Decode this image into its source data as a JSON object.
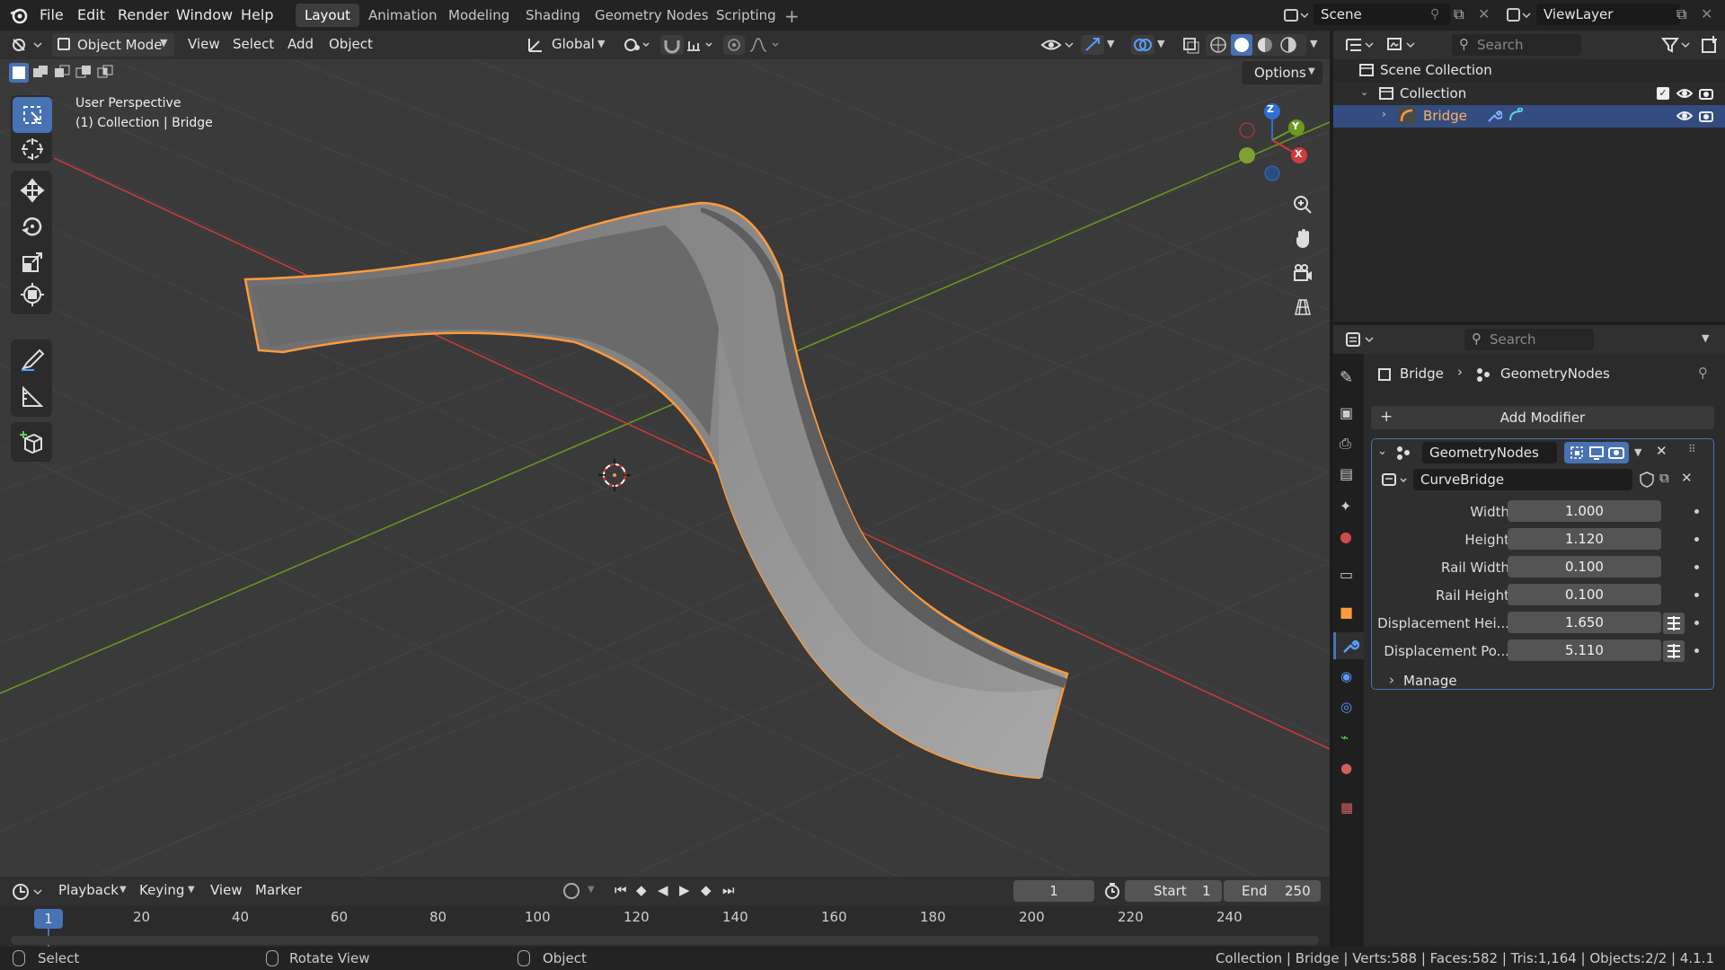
{
  "menu": {
    "file": "File",
    "edit": "Edit",
    "render": "Render",
    "window": "Window",
    "help": "Help"
  },
  "workspaces": [
    "Layout",
    "Animation",
    "Modeling",
    "Shading",
    "Geometry Nodes",
    "Scripting"
  ],
  "scene": {
    "name": "Scene",
    "view_layer": "ViewLayer"
  },
  "viewport_header": {
    "mode": "Object Mode",
    "view": "View",
    "select": "Select",
    "add": "Add",
    "object": "Object",
    "orientation": "Global",
    "options": "Options"
  },
  "viewport": {
    "perspective": "User Perspective",
    "collection_info": "(1) Collection | Bridge",
    "axis_z": "Z",
    "axis_y": "Y",
    "axis_x": "X"
  },
  "outliner": {
    "search_placeholder": "Search",
    "scene_collection": "Scene Collection",
    "collection": "Collection",
    "object": "Bridge"
  },
  "properties": {
    "search_placeholder": "Search",
    "breadcrumb_object": "Bridge",
    "breadcrumb_modifier": "GeometryNodes",
    "add_modifier": "Add Modifier",
    "modifier_name": "GeometryNodes",
    "node_group": "CurveBridge",
    "inputs": [
      {
        "label": "Width",
        "value": "1.000"
      },
      {
        "label": "Height",
        "value": "1.120"
      },
      {
        "label": "Rail Width",
        "value": "0.100"
      },
      {
        "label": "Rail Height",
        "value": "0.100"
      },
      {
        "label": "Displacement Hei...",
        "value": "1.650"
      },
      {
        "label": "Displacement Po...",
        "value": "5.110"
      }
    ],
    "manage": "Manage"
  },
  "timeline": {
    "playback": "Playback",
    "keying": "Keying",
    "view": "View",
    "marker": "Marker",
    "current_frame": "1",
    "start_label": "Start",
    "start": "1",
    "end_label": "End",
    "end": "250",
    "ticks": [
      "1",
      "20",
      "40",
      "60",
      "80",
      "100",
      "120",
      "140",
      "160",
      "180",
      "200",
      "220",
      "240"
    ]
  },
  "statusbar": {
    "select": "Select",
    "rotate": "Rotate View",
    "object": "Object",
    "stats": "Collection | Bridge | Verts:588 | Faces:582 | Tris:1,164 | Objects:2/2 | 4.1.1"
  },
  "colors": {
    "accent": "#4772b3",
    "selection": "#ff9a3c",
    "x_axis": "#d03a3a",
    "y_axis": "#6b9a1f",
    "z_axis": "#2f6fd0"
  }
}
